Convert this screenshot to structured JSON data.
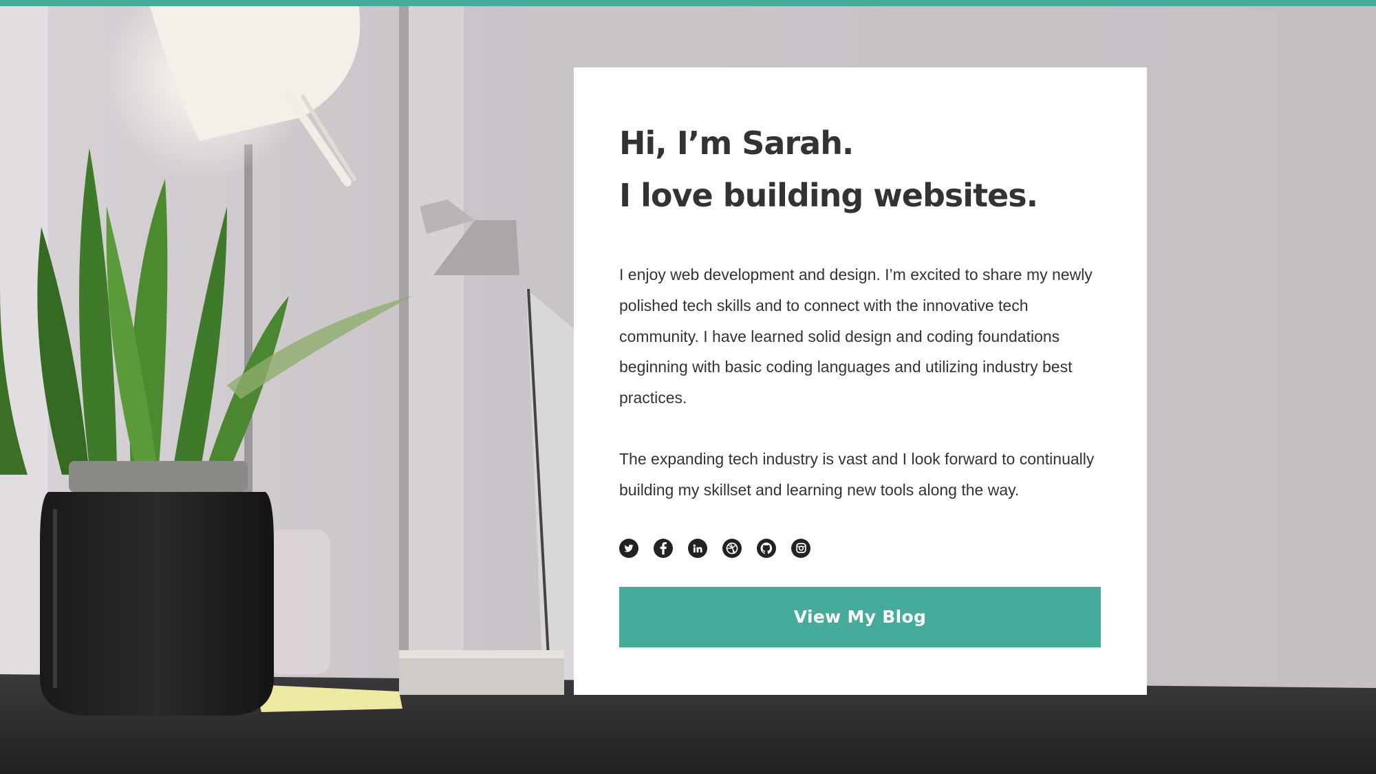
{
  "colors": {
    "accent": "#46ab9b",
    "card_background": "#ffffff",
    "text": "#333333"
  },
  "hero": {
    "headline_line1": "Hi, I’m Sarah.",
    "headline_line2": "I love building websites.",
    "paragraph_1": "I enjoy web development and design. I’m excited to share my newly polished tech skills and to connect with the innovative tech community. I have learned solid design and coding foundations beginning with basic coding languages and utilizing industry best practices.",
    "paragraph_2": "The expanding tech industry is vast and I look forward to continually building my skillset and learning new tools along the way."
  },
  "social": [
    {
      "icon": "twitter-icon"
    },
    {
      "icon": "facebook-icon"
    },
    {
      "icon": "linkedin-icon"
    },
    {
      "icon": "dribbble-icon"
    },
    {
      "icon": "github-icon"
    },
    {
      "icon": "instagram-icon"
    }
  ],
  "cta": {
    "label": "View My Blog"
  }
}
